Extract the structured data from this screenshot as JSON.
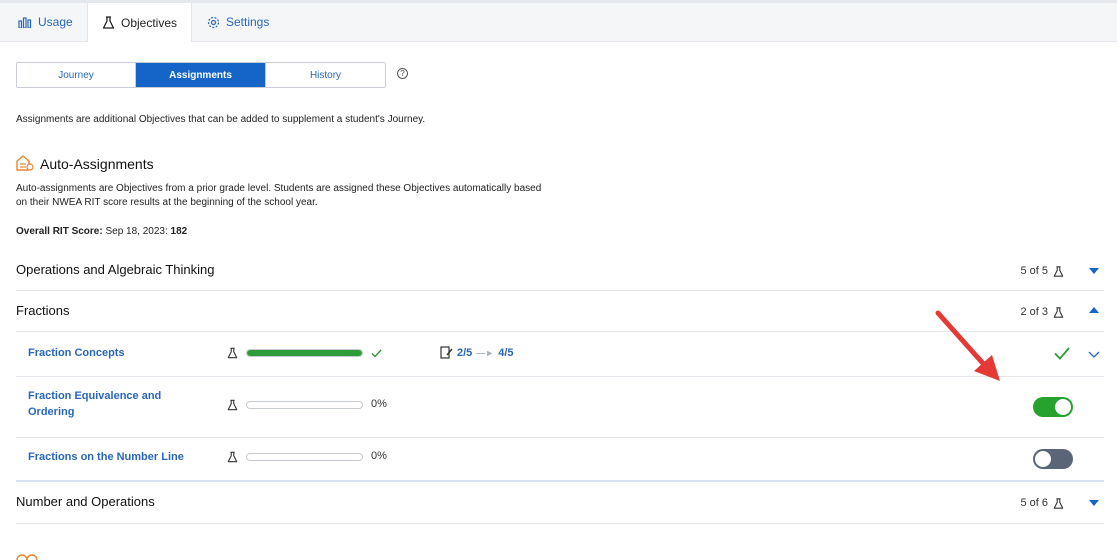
{
  "tabs": [
    {
      "label": "Usage",
      "icon": "bar-chart-icon",
      "active": false
    },
    {
      "label": "Objectives",
      "icon": "flask-icon",
      "active": true
    },
    {
      "label": "Settings",
      "icon": "gear-icon",
      "active": false
    }
  ],
  "segments": [
    {
      "label": "Journey",
      "active": false
    },
    {
      "label": "Assignments",
      "active": true
    },
    {
      "label": "History",
      "active": false
    }
  ],
  "help_icon": "?",
  "intro": "Assignments are additional Objectives that can be added to supplement a student's Journey.",
  "auto": {
    "title": "Auto-Assignments",
    "description": "Auto-assignments are Objectives from a prior grade level. Students are assigned these Objectives automatically based on their NWEA RIT score results at the beginning of the school year.",
    "rit_label": "Overall RIT Score:",
    "rit_date": "Sep 18, 2023:",
    "rit_value": "182"
  },
  "sections": [
    {
      "title": "Operations and Algebraic Thinking",
      "count": "5 of 5",
      "expanded": false
    },
    {
      "title": "Fractions",
      "count": "2 of 3",
      "expanded": true
    },
    {
      "title": "Number and Operations",
      "count": "5 of 6",
      "expanded": false
    }
  ],
  "objectives": [
    {
      "name": "Fraction Concepts",
      "progress": 1.0,
      "status": "complete",
      "assess_from": "2/5",
      "assess_to": "4/5"
    },
    {
      "name": "Fraction Equivalence and Ordering",
      "progress": 0,
      "percent": "0%",
      "toggle": "on"
    },
    {
      "name": "Fractions on the Number Line",
      "progress": 0,
      "percent": "0%",
      "toggle": "off"
    }
  ],
  "colors": {
    "accent": "#1565c8",
    "link": "#2a66b8",
    "success": "#2e9b3a",
    "toggle_off": "#5a6577",
    "annotation": "#e53935"
  }
}
